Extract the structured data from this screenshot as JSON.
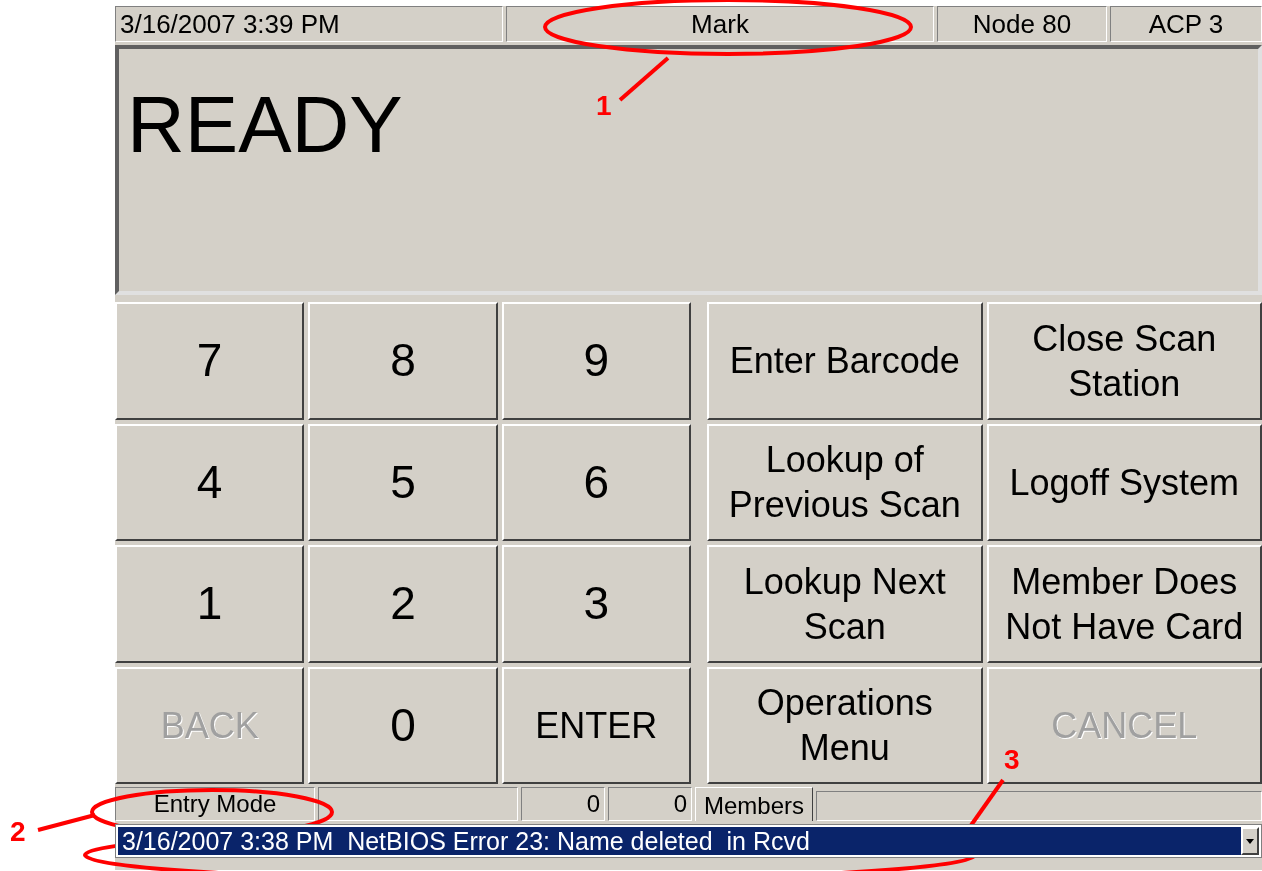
{
  "top_bar": [
    {
      "text": "3/16/2007 3:39 PM"
    },
    {
      "text": "Mark"
    },
    {
      "text": "Node 80"
    },
    {
      "text": "ACP 3"
    }
  ],
  "display": {
    "message": "READY"
  },
  "keypad": [
    {
      "label": "7",
      "disabled": false
    },
    {
      "label": "8",
      "disabled": false
    },
    {
      "label": "9",
      "disabled": false
    },
    {
      "label": "4",
      "disabled": false
    },
    {
      "label": "5",
      "disabled": false
    },
    {
      "label": "6",
      "disabled": false
    },
    {
      "label": "1",
      "disabled": false
    },
    {
      "label": "2",
      "disabled": false
    },
    {
      "label": "3",
      "disabled": false
    },
    {
      "label": "BACK",
      "disabled": true
    },
    {
      "label": "0",
      "disabled": false
    },
    {
      "label": "ENTER",
      "disabled": false
    }
  ],
  "function_key_rows": [
    {
      "keys": [
        {
          "label": "Enter Barcode",
          "disabled": false
        },
        {
          "label": "Close Scan Station",
          "disabled": false
        }
      ]
    },
    {
      "keys": [
        {
          "label": "Lookup of Previous Scan",
          "disabled": false
        },
        {
          "label": "Logoff System",
          "disabled": false
        }
      ]
    },
    {
      "keys": [
        {
          "label": "Lookup Next Scan",
          "disabled": false
        },
        {
          "label": "Member Does Not Have Card",
          "disabled": false
        }
      ]
    },
    {
      "keys": [
        {
          "label": "Operations Menu",
          "disabled": false
        },
        {
          "label": "CANCEL",
          "disabled": true
        }
      ]
    }
  ],
  "status_fields": [
    {
      "text": "Entry Mode"
    },
    {
      "text": "0"
    },
    {
      "text": "0"
    }
  ],
  "tabs": [
    {
      "label": "Members",
      "selected": true
    }
  ],
  "message_log": {
    "text": "3/16/2007 3:38 PM  NetBIOS Error 23: Name deleted  in Rcvd",
    "selected": true
  },
  "annotations": [
    {
      "label": "1"
    },
    {
      "label": "2"
    },
    {
      "label": "3"
    }
  ]
}
